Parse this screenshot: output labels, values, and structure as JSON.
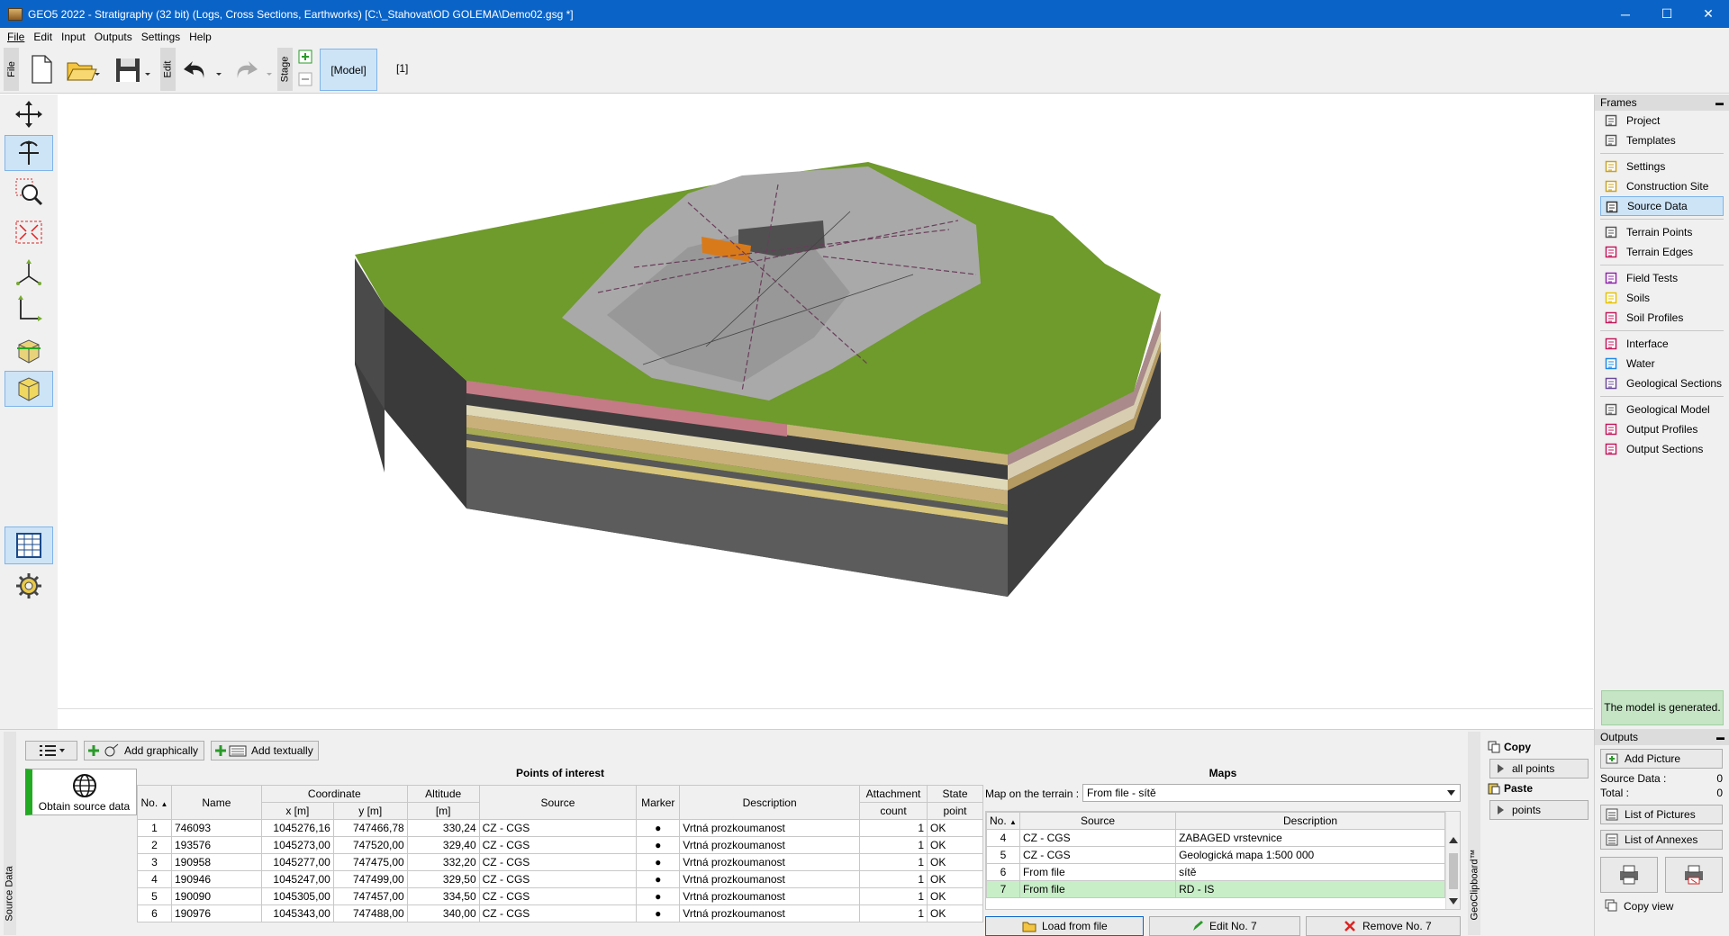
{
  "window": {
    "title": "GEO5 2022 - Stratigraphy (32 bit) (Logs, Cross Sections, Earthworks) [C:\\_Stahovat\\OD GOLEMA\\Demo02.gsg *]",
    "minimize": "─",
    "maximize": "☐",
    "close": "✕"
  },
  "menu": [
    "File",
    "Edit",
    "Input",
    "Outputs",
    "Settings",
    "Help"
  ],
  "toolbar": {
    "file_label": "File",
    "edit_label": "Edit",
    "stage_label": "Stage",
    "model_button": "[Model]",
    "stage_one": "[1]"
  },
  "frames": {
    "header": "Frames",
    "collapse": "▬",
    "groups": [
      [
        {
          "label": "Project",
          "icon": "project-icon"
        },
        {
          "label": "Templates",
          "icon": "templates-icon"
        }
      ],
      [
        {
          "label": "Settings",
          "icon": "settings-icon"
        },
        {
          "label": "Construction Site",
          "icon": "construction-site-icon"
        },
        {
          "label": "Source Data",
          "icon": "globe-icon",
          "active": true
        }
      ],
      [
        {
          "label": "Terrain Points",
          "icon": "terrain-points-icon"
        },
        {
          "label": "Terrain Edges",
          "icon": "terrain-edges-icon"
        }
      ],
      [
        {
          "label": "Field Tests",
          "icon": "field-tests-icon"
        },
        {
          "label": "Soils",
          "icon": "soils-icon"
        },
        {
          "label": "Soil Profiles",
          "icon": "soil-profiles-icon"
        }
      ],
      [
        {
          "label": "Interface",
          "icon": "interface-icon"
        },
        {
          "label": "Water",
          "icon": "water-icon"
        },
        {
          "label": "Geological Sections",
          "icon": "geological-sections-icon"
        }
      ],
      [
        {
          "label": "Geological Model",
          "icon": "geological-model-icon"
        },
        {
          "label": "Output Profiles",
          "icon": "output-profiles-icon"
        },
        {
          "label": "Output Sections",
          "icon": "output-sections-icon"
        }
      ]
    ],
    "model_status": "The model is generated."
  },
  "outputs": {
    "header": "Outputs",
    "add_picture": "Add Picture",
    "source_data_label": "Source Data :",
    "source_data_value": "0",
    "total_label": "Total :",
    "total_value": "0",
    "list_of_pictures": "List of Pictures",
    "list_of_annexes": "List of Annexes",
    "copy_view": "Copy view"
  },
  "bottom": {
    "side_tab": "Source Data",
    "add_graphically": "Add graphically",
    "add_textually": "Add textually",
    "obtain_source_data": "Obtain source data",
    "poi_title": "Points of interest",
    "poi_headers": {
      "no": "No.",
      "name": "Name",
      "coordinate": "Coordinate",
      "x": "x [m]",
      "y": "y [m]",
      "altitude": "Altitude",
      "altitude_unit": "[m]",
      "source": "Source",
      "marker": "Marker",
      "description": "Description",
      "attachment1": "Attachment",
      "attachment2": "count",
      "state1": "State",
      "state2": "point"
    },
    "poi_rows": [
      {
        "no": "1",
        "name": "746093",
        "x": "1045276,16",
        "y": "747466,78",
        "alt": "330,24",
        "source": "CZ - CGS",
        "marker": "●",
        "desc": "Vrtná prozkoumanost",
        "att": "1",
        "state": "OK"
      },
      {
        "no": "2",
        "name": "193576",
        "x": "1045273,00",
        "y": "747520,00",
        "alt": "329,40",
        "source": "CZ - CGS",
        "marker": "●",
        "desc": "Vrtná prozkoumanost",
        "att": "1",
        "state": "OK"
      },
      {
        "no": "3",
        "name": "190958",
        "x": "1045277,00",
        "y": "747475,00",
        "alt": "332,20",
        "source": "CZ - CGS",
        "marker": "●",
        "desc": "Vrtná prozkoumanost",
        "att": "1",
        "state": "OK"
      },
      {
        "no": "4",
        "name": "190946",
        "x": "1045247,00",
        "y": "747499,00",
        "alt": "329,50",
        "source": "CZ - CGS",
        "marker": "●",
        "desc": "Vrtná prozkoumanost",
        "att": "1",
        "state": "OK"
      },
      {
        "no": "5",
        "name": "190090",
        "x": "1045305,00",
        "y": "747457,00",
        "alt": "334,50",
        "source": "CZ - CGS",
        "marker": "●",
        "desc": "Vrtná prozkoumanost",
        "att": "1",
        "state": "OK"
      },
      {
        "no": "6",
        "name": "190976",
        "x": "1045343,00",
        "y": "747488,00",
        "alt": "340,00",
        "source": "CZ - CGS",
        "marker": "●",
        "desc": "Vrtná prozkoumanost",
        "att": "1",
        "state": "OK"
      }
    ],
    "maps_title": "Maps",
    "map_on_terrain_label": "Map on the terrain :",
    "map_on_terrain_value": "From file - sítě",
    "maps_headers": {
      "no": "No.",
      "source": "Source",
      "description": "Description"
    },
    "maps_rows": [
      {
        "no": "4",
        "source": "CZ - CGS",
        "desc": "ZABAGED vrstevnice"
      },
      {
        "no": "5",
        "source": "CZ - CGS",
        "desc": "Geologická mapa 1:500 000"
      },
      {
        "no": "6",
        "source": "From file",
        "desc": "sítě"
      },
      {
        "no": "7",
        "source": "From file",
        "desc": "RD - IS",
        "selected": true
      }
    ],
    "load_from_file": "Load from file",
    "edit_no": "Edit No. 7",
    "remove_no": "Remove No. 7",
    "geoclipboard": "GeoClipboard™",
    "copy": "Copy",
    "all_points": "all points",
    "paste": "Paste",
    "points": "points"
  },
  "colors": {
    "titlebar": "#0a64c8",
    "active_bg": "#cde4f7",
    "status_green": "#c5e5c5",
    "grass": "#6f9a2c",
    "selected_row": "#c8eec8"
  }
}
